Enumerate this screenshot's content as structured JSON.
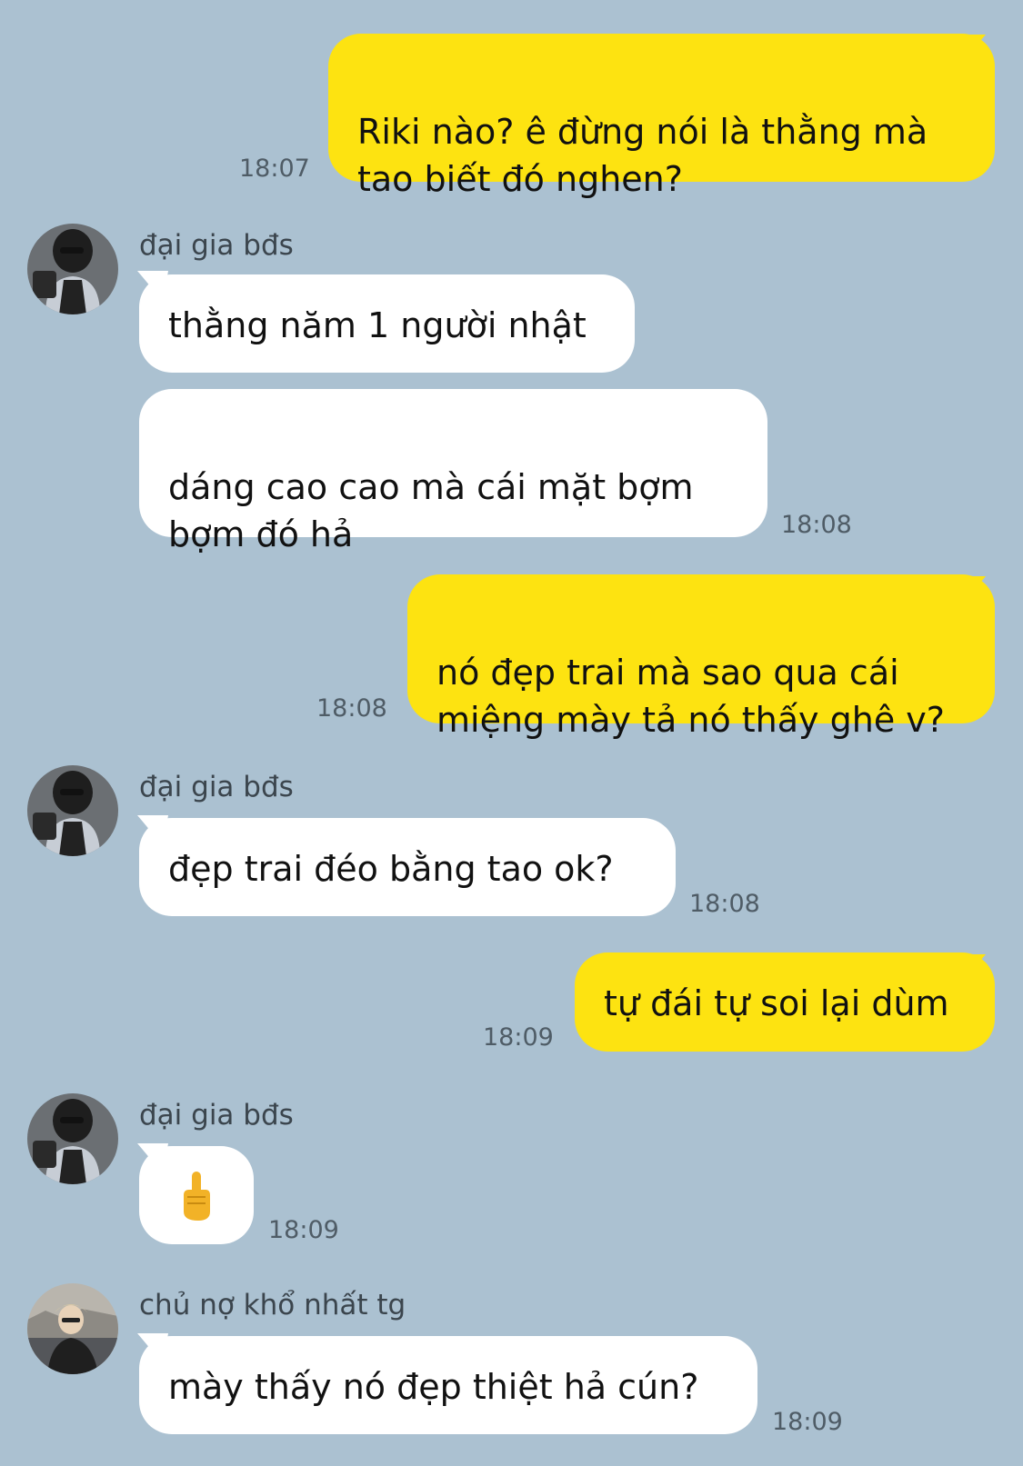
{
  "messages": [
    {
      "sender": "me",
      "text": "Riki nào? ê đừng nói là thằng mà\ntao biết đó nghen?",
      "time": "18:07"
    },
    {
      "sender": "đại gia bđs",
      "text": "thằng năm 1 người nhật"
    },
    {
      "sender": "đại gia bđs",
      "text": "dáng cao cao mà cái mặt bợm\nbợm đó hả",
      "time": "18:08"
    },
    {
      "sender": "me",
      "text": "nó đẹp trai mà sao qua cái\nmiệng mày tả nó thấy ghê v?",
      "time": "18:08"
    },
    {
      "sender": "đại gia bđs",
      "text": "đẹp trai đéo bằng tao ok?",
      "time": "18:08"
    },
    {
      "sender": "me",
      "text": "tự đái tự soi lại dùm",
      "time": "18:09"
    },
    {
      "sender": "đại gia bđs",
      "emoji": "middle-finger-emoji",
      "time": "18:09"
    },
    {
      "sender": "chủ nợ khổ nhất tg",
      "text": "mày thấy nó đẹp thiệt hả cún?",
      "time": "18:09"
    }
  ],
  "colors": {
    "background": "#abc1d1",
    "outgoing": "#fde311",
    "incoming": "#ffffff"
  }
}
